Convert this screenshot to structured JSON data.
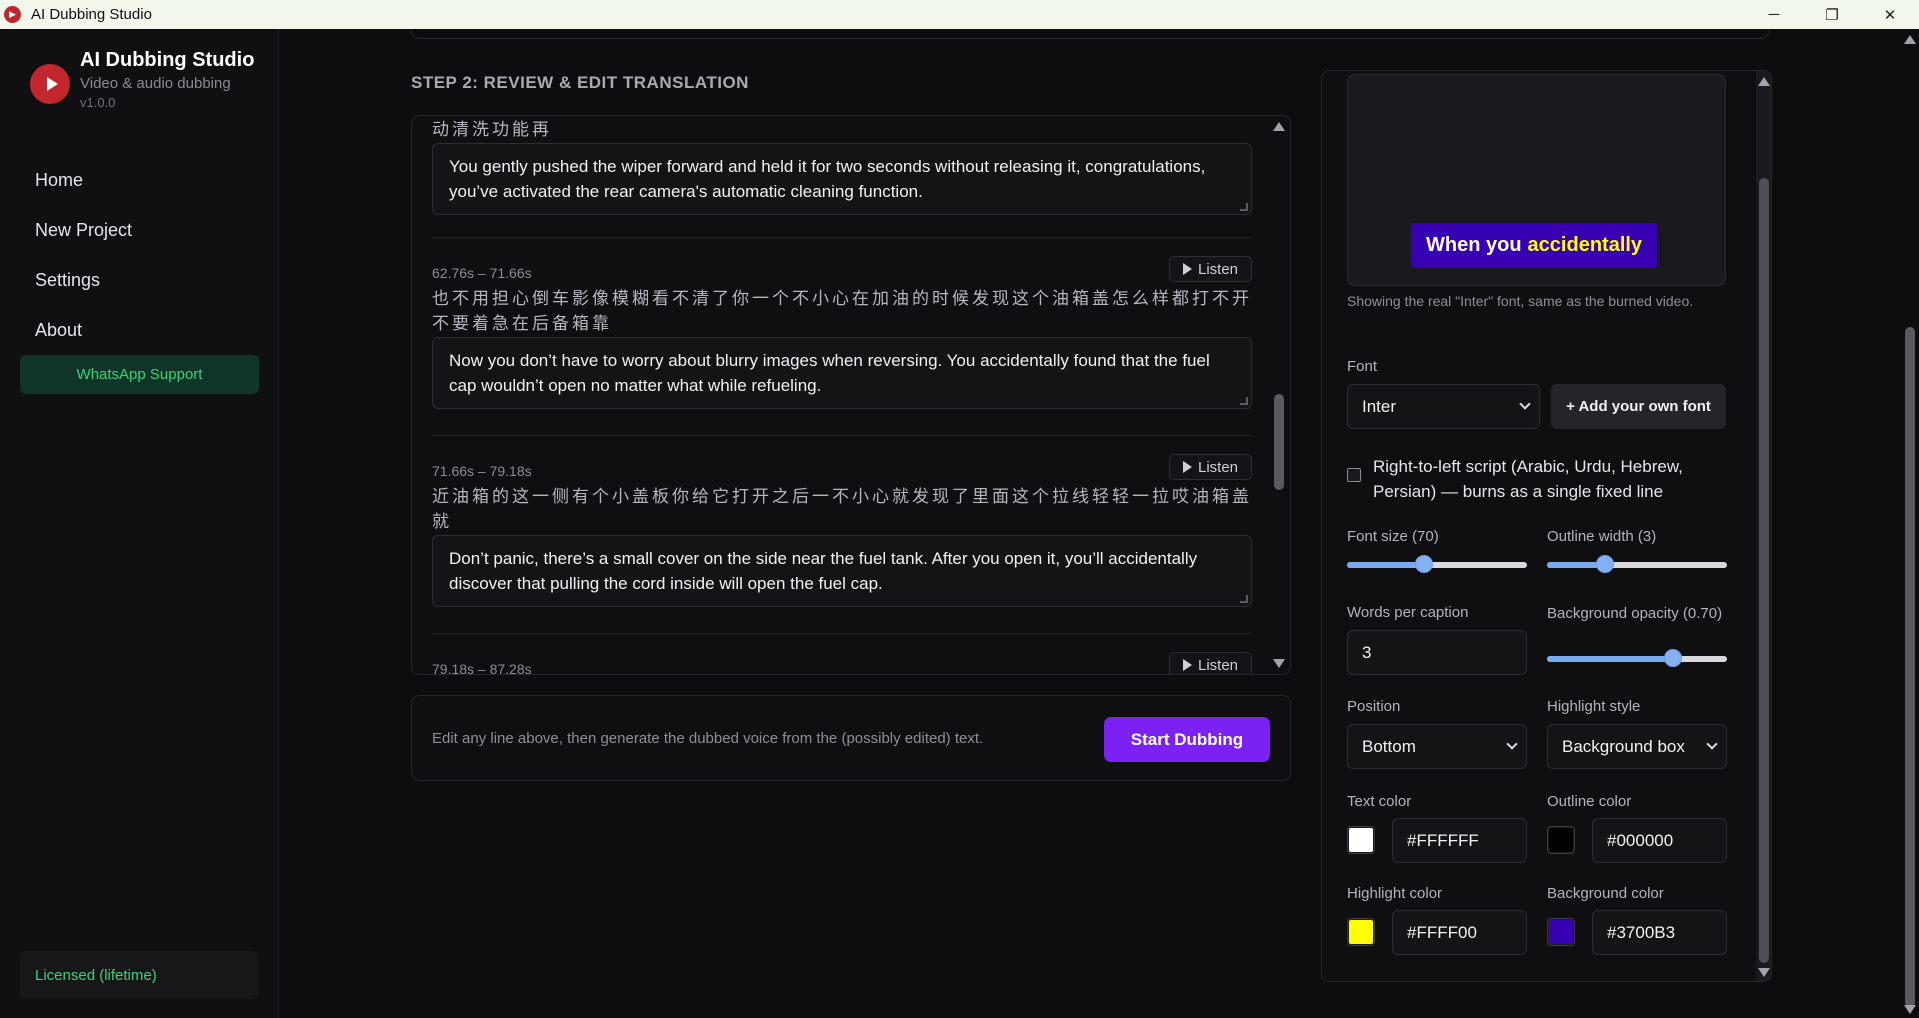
{
  "window": {
    "title": "AI Dubbing Studio",
    "minimize": "─",
    "maximize": "❐",
    "close": "✕"
  },
  "sidebar": {
    "brand_name": "AI Dubbing Studio",
    "brand_sub": "Video & audio dubbing",
    "version": "v1.0.0",
    "items": [
      {
        "label": "Home"
      },
      {
        "label": "New Project"
      },
      {
        "label": "Settings"
      },
      {
        "label": "About"
      }
    ],
    "whatsapp": "WhatsApp Support",
    "license": "Licensed (lifetime)"
  },
  "main": {
    "step_title": "STEP 2: REVIEW & EDIT TRANSLATION",
    "top_cn": "动清洗功能再",
    "top_text": "You gently pushed the wiper forward and held it for two seconds without releasing it, congratulations, you’ve activated the rear camera's automatic cleaning function.",
    "listen_label": "Listen",
    "segments": [
      {
        "time": "62.76s – 71.66s",
        "cn": "也不用担心倒车影像模糊看不清了你一个不小心在加油的时候发现这个油箱盖怎么样都打不开不要着急在后备箱靠",
        "text": "Now you don’t have to worry about blurry images when reversing. You accidentally found that the fuel cap wouldn’t open no matter what while refueling."
      },
      {
        "time": "71.66s – 79.18s",
        "cn": "近油箱的这一侧有个小盖板你给它打开之后一不小心就发现了里面这个拉线轻轻一拉哎油箱盖就",
        "text": "Don’t panic, there’s a small cover on the side near the fuel tank. After you open it, you’ll accidentally discover that pulling the cord inside will open the fuel cap."
      },
      {
        "time": "79.18s – 87.28s"
      }
    ],
    "footer_hint": "Edit any line above, then generate the dubbed voice from the (possibly edited) text.",
    "start_button": "Start Dubbing"
  },
  "panel": {
    "preview": {
      "caption_plain": "When you",
      "caption_highlight": "accidentally"
    },
    "font_note": "Showing the real \"Inter\" font, same as the burned video.",
    "font_label": "Font",
    "font_value": "Inter",
    "add_font": "+ Add your own font",
    "rtl_label": "Right-to-left script (Arabic, Urdu, Hebrew, Persian) — burns as a single fixed line",
    "font_size_label": "Font size (70)",
    "outline_width_label": "Outline width (3)",
    "font_size_level": 0.43,
    "outline_width_level": 0.32,
    "words_per_caption_label": "Words per caption",
    "words_per_caption_value": "3",
    "bg_opacity_label": "Background opacity (0.70)",
    "bg_opacity_level": 0.7,
    "position_label": "Position",
    "position_value": "Bottom",
    "highlight_style_label": "Highlight style",
    "highlight_style_value": "Background box",
    "text_color_label": "Text color",
    "text_color": "#FFFFFF",
    "outline_color_label": "Outline color",
    "outline_color": "#000000",
    "highlight_color_label": "Highlight color",
    "highlight_color": "#FFFF00",
    "background_color_label": "Background color",
    "background_color": "#3700B3"
  }
}
